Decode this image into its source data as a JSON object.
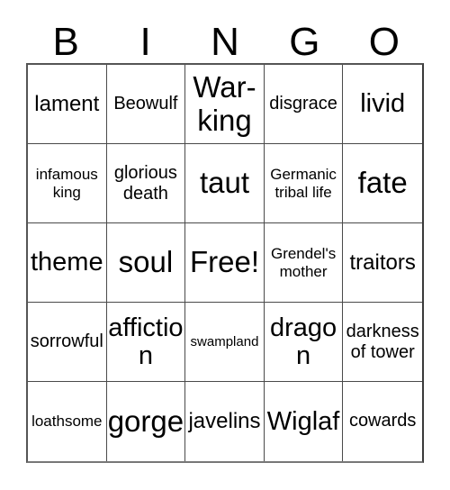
{
  "card": {
    "title": "Bingo Card",
    "header_letters": [
      "B",
      "I",
      "N",
      "G",
      "O"
    ],
    "columns": 5,
    "rows": 5,
    "free_space": {
      "row": 3,
      "column": 3,
      "label": "Free!"
    },
    "colors": {
      "background": "#ffffff",
      "text": "#000000",
      "grid_line": "#4a4a4a",
      "outer_border": "#555555"
    },
    "cells": [
      [
        {
          "label": "lament",
          "size": "lg"
        },
        {
          "label": "Beowulf",
          "size": "md"
        },
        {
          "label": "War-king",
          "size": "xxl"
        },
        {
          "label": "disgrace",
          "size": "md"
        },
        {
          "label": "livid",
          "size": "xl"
        }
      ],
      [
        {
          "label": "infamous king",
          "size": "sm"
        },
        {
          "label": "glorious death",
          "size": "md"
        },
        {
          "label": "taut",
          "size": "xxl"
        },
        {
          "label": "Germanic tribal life",
          "size": "sm"
        },
        {
          "label": "fate",
          "size": "xxl"
        }
      ],
      [
        {
          "label": "theme",
          "size": "xl"
        },
        {
          "label": "soul",
          "size": "xxl"
        },
        {
          "label": "Free!",
          "size": "xxl"
        },
        {
          "label": "Grendel's mother",
          "size": "sm"
        },
        {
          "label": "traitors",
          "size": "lg"
        }
      ],
      [
        {
          "label": "sorrowful",
          "size": "md"
        },
        {
          "label": "affiction",
          "size": "xl"
        },
        {
          "label": "swampland",
          "size": "xs"
        },
        {
          "label": "dragon",
          "size": "xl"
        },
        {
          "label": "darkness of tower",
          "size": "md"
        }
      ],
      [
        {
          "label": "loathsome",
          "size": "sm"
        },
        {
          "label": "gorge",
          "size": "xxl"
        },
        {
          "label": "javelins",
          "size": "lg"
        },
        {
          "label": "Wiglaf",
          "size": "xl"
        },
        {
          "label": "cowards",
          "size": "md"
        }
      ]
    ]
  }
}
